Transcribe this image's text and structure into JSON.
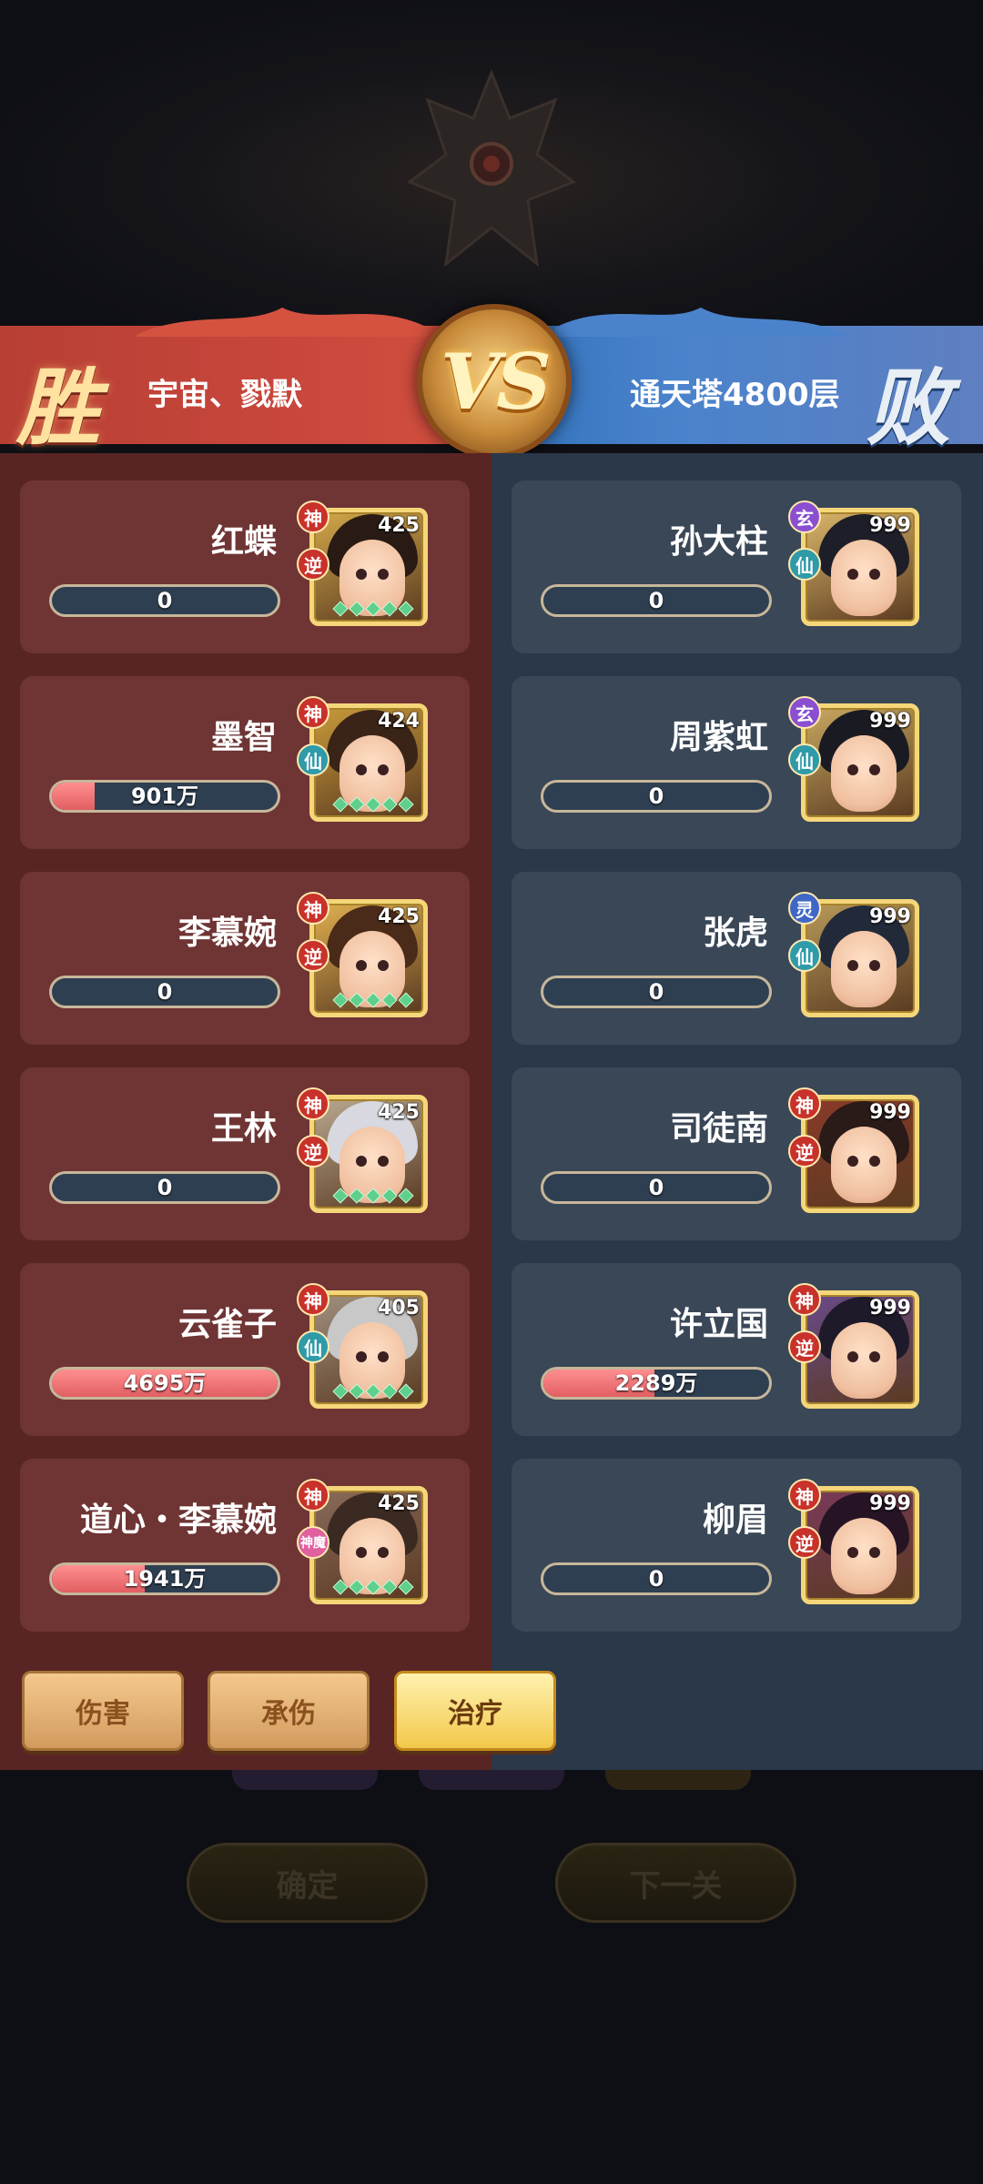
{
  "header": {
    "win_label": "胜",
    "lose_label": "败",
    "vs_label": "VS",
    "left_team": "宇宙、戮默",
    "right_team": "通天塔4800层"
  },
  "colors": {
    "win_red": "#c9473c",
    "lose_blue": "#4a83cc",
    "tag_shen": "#c8322b",
    "tag_xuan": "#8a4fd0",
    "tag_ling": "#3f67c6",
    "tag_xian": "#2f9aa8",
    "tag_ni": "#c8322b",
    "tag_shenmo": "#e060a0"
  },
  "left_heroes": [
    {
      "name": "红蝶",
      "value": "0",
      "fill": 0,
      "level": "425",
      "tag1": "神",
      "tag2": "逆",
      "tag2_icon": "ni-tag"
    },
    {
      "name": "墨智",
      "value": "901万",
      "fill": 0.19,
      "level": "424",
      "tag1": "神",
      "tag2": "仙",
      "tag2_icon": "xian-tag"
    },
    {
      "name": "李慕婉",
      "value": "0",
      "fill": 0,
      "level": "425",
      "tag1": "神",
      "tag2": "逆",
      "tag2_icon": "ni-tag"
    },
    {
      "name": "王林",
      "value": "0",
      "fill": 0,
      "level": "425",
      "tag1": "神",
      "tag2": "逆",
      "tag2_icon": "ni-tag"
    },
    {
      "name": "云雀子",
      "value": "4695万",
      "fill": 1.0,
      "level": "405",
      "tag1": "神",
      "tag2": "仙",
      "tag2_icon": "xian-tag"
    },
    {
      "name": "道心・李慕婉",
      "value": "1941万",
      "fill": 0.41,
      "level": "425",
      "tag1": "神",
      "tag2": "神魔",
      "tag2_icon": "shenmo-tag"
    }
  ],
  "right_heroes": [
    {
      "name": "孙大柱",
      "value": "0",
      "fill": 0,
      "level": "999",
      "tag1": "玄",
      "tag2": "仙"
    },
    {
      "name": "周紫虹",
      "value": "0",
      "fill": 0,
      "level": "999",
      "tag1": "玄",
      "tag2": "仙"
    },
    {
      "name": "张虎",
      "value": "0",
      "fill": 0,
      "level": "999",
      "tag1": "灵",
      "tag2": "仙"
    },
    {
      "name": "司徒南",
      "value": "0",
      "fill": 0,
      "level": "999",
      "tag1": "神",
      "tag2": "逆"
    },
    {
      "name": "许立国",
      "value": "2289万",
      "fill": 0.49,
      "level": "999",
      "tag1": "神",
      "tag2": "逆"
    },
    {
      "name": "柳眉",
      "value": "0",
      "fill": 0,
      "level": "999",
      "tag1": "神",
      "tag2": "逆"
    }
  ],
  "tabs": [
    {
      "label": "伤害",
      "active": false
    },
    {
      "label": "承伤",
      "active": false
    },
    {
      "label": "治疗",
      "active": true
    }
  ],
  "background_buttons": {
    "confirm": "确定",
    "next": "下一关"
  }
}
